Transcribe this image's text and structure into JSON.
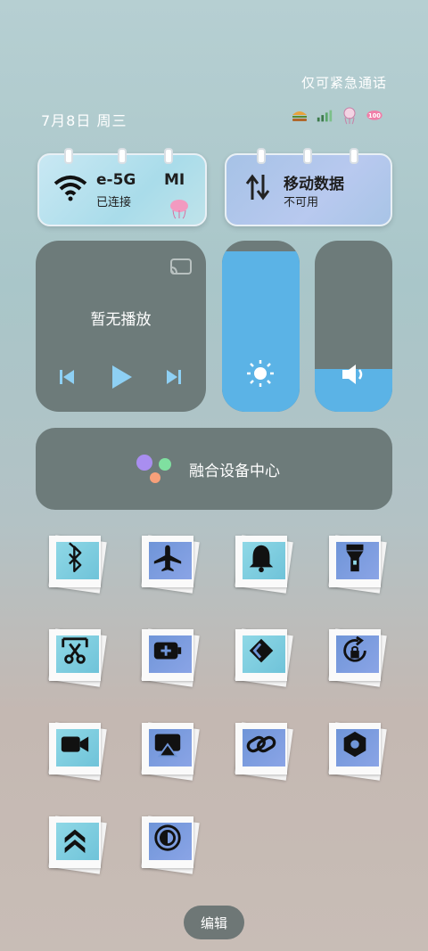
{
  "status": {
    "emergency_text": "仅可紧急通话",
    "date_text": "7月8日 周三"
  },
  "cards": {
    "wifi": {
      "title_left": "e-5G",
      "title_right": "MI",
      "subtitle": "已连接"
    },
    "data": {
      "title": "移动数据",
      "subtitle": "不可用"
    }
  },
  "media": {
    "text": "暂无播放"
  },
  "sliders": {
    "brightness_level": 0.94,
    "volume_level": 0.25
  },
  "fusion": {
    "label": "融合设备中心"
  },
  "tiles": [
    {
      "icon": "bluetooth-icon"
    },
    {
      "icon": "airplane-icon"
    },
    {
      "icon": "bell-icon"
    },
    {
      "icon": "flashlight-icon"
    },
    {
      "icon": "screenshot-icon"
    },
    {
      "icon": "battery-saver-icon"
    },
    {
      "icon": "dc-icon"
    },
    {
      "icon": "rotation-lock-icon"
    },
    {
      "icon": "video-icon"
    },
    {
      "icon": "screen-cast-icon"
    },
    {
      "icon": "link-icon"
    },
    {
      "icon": "hexagon-settings-icon"
    },
    {
      "icon": "double-chevron-up-icon"
    },
    {
      "icon": "contrast-icon"
    }
  ],
  "edit": {
    "label": "编辑"
  }
}
